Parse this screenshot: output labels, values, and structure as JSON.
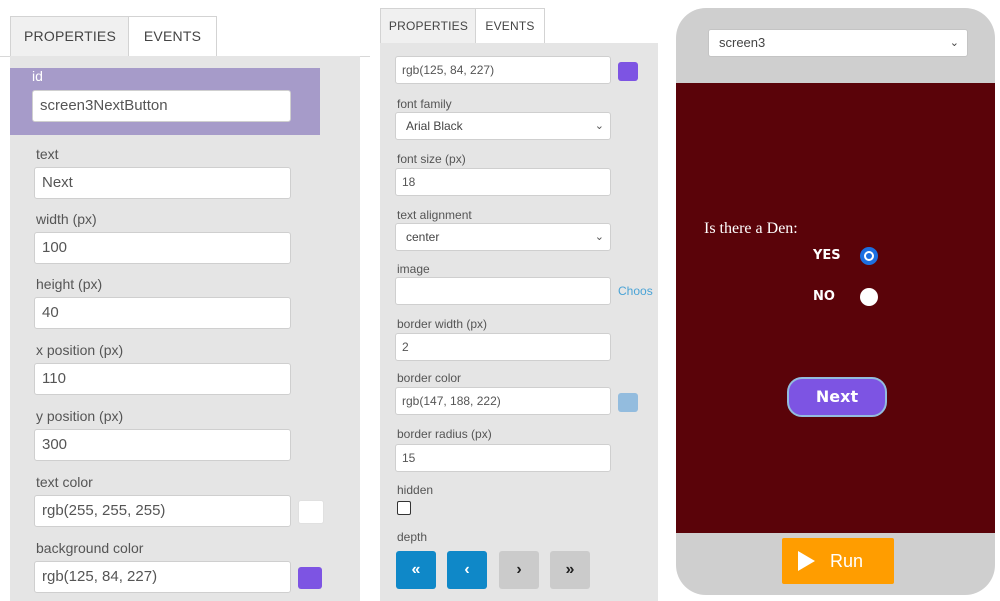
{
  "left_panel": {
    "tabs": {
      "properties": "PROPERTIES",
      "events": "EVENTS"
    },
    "fields": {
      "id": {
        "label": "id",
        "value": "screen3NextButton"
      },
      "text": {
        "label": "text",
        "value": "Next"
      },
      "width": {
        "label": "width (px)",
        "value": "100"
      },
      "height": {
        "label": "height (px)",
        "value": "40"
      },
      "x": {
        "label": "x position (px)",
        "value": "110"
      },
      "y": {
        "label": "y position (px)",
        "value": "300"
      },
      "text_color": {
        "label": "text color",
        "value": "rgb(255, 255, 255)",
        "swatch": "#ffffff"
      },
      "background_color": {
        "label": "background color",
        "value": "rgb(125, 84, 227)",
        "swatch": "#7d54e3"
      }
    }
  },
  "middle_panel": {
    "tabs": {
      "properties": "PROPERTIES",
      "events": "EVENTS"
    },
    "top_color": {
      "value": "rgb(125, 84, 227)",
      "swatch": "#7d54e3"
    },
    "font_family": {
      "label": "font family",
      "value": "Arial Black"
    },
    "font_size": {
      "label": "font size (px)",
      "value": "18"
    },
    "text_alignment": {
      "label": "text alignment",
      "value": "center"
    },
    "image": {
      "label": "image",
      "value": "",
      "choose_label": "Choos"
    },
    "border_width": {
      "label": "border width (px)",
      "value": "2"
    },
    "border_color": {
      "label": "border color",
      "value": "rgb(147, 188, 222)",
      "swatch": "#93bcde"
    },
    "border_radius": {
      "label": "border radius (px)",
      "value": "15"
    },
    "hidden": {
      "label": "hidden",
      "checked": false
    },
    "depth": {
      "label": "depth",
      "buttons": [
        "«",
        "‹",
        "›",
        "»"
      ]
    }
  },
  "phone": {
    "screen_select": "screen3",
    "question": "Is there a Den:",
    "options": [
      {
        "label": "YES",
        "selected": true
      },
      {
        "label": "NO",
        "selected": false
      }
    ],
    "next_button": "Next",
    "run_button": "Run"
  },
  "colors": {
    "screen_bg": "#5a0309",
    "accent_purple": "#7d54e3",
    "depth_blue": "#0f88c8",
    "run_orange": "#ff9d00"
  }
}
